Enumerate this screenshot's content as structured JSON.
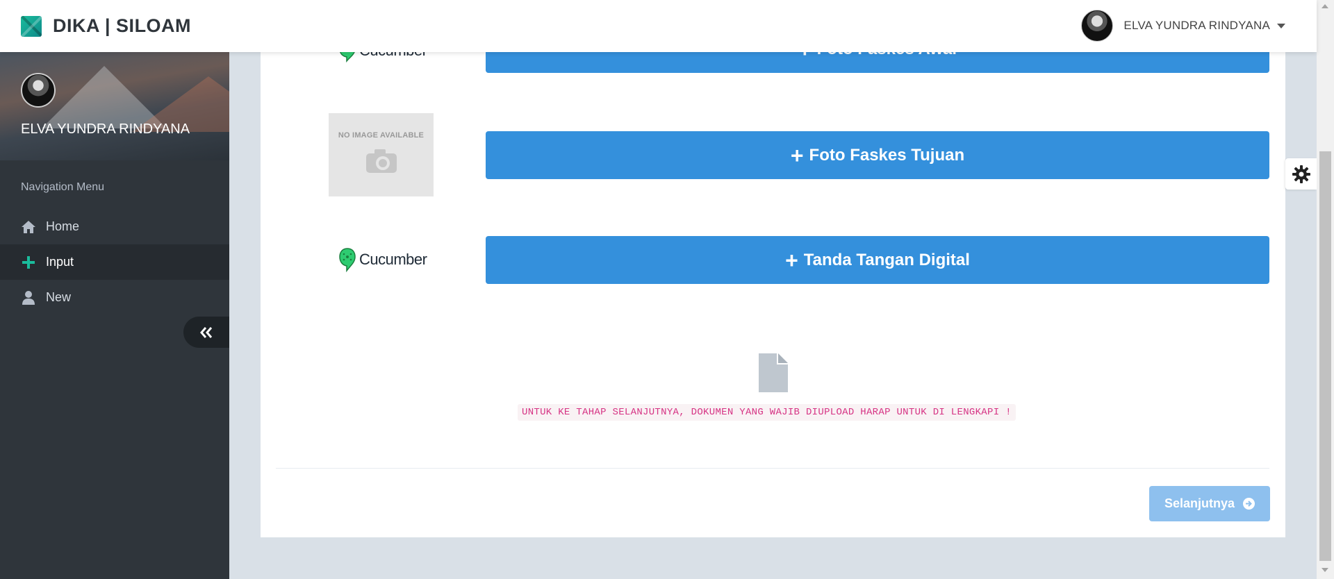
{
  "brand": {
    "name": "DIKA | SILOAM"
  },
  "user": {
    "name": "ELVA YUNDRA RINDYANA"
  },
  "sidebar": {
    "profile_name": "ELVA YUNDRA RINDYANA",
    "nav_header": "Navigation Menu",
    "items": [
      {
        "label": "Home",
        "icon": "home-icon"
      },
      {
        "label": "Input",
        "icon": "plus-icon",
        "active": true
      },
      {
        "label": "New",
        "icon": "user-icon"
      }
    ]
  },
  "uploads": [
    {
      "label": "Foto Faskes Awal",
      "thumb": "Cucumber"
    },
    {
      "label": "Foto Faskes Tujuan",
      "thumb_text": "NO IMAGE AVAILABLE"
    },
    {
      "label": "Tanda Tangan Digital",
      "thumb": "Cucumber"
    }
  ],
  "warning": "UNTUK KE TAHAP SELANJUTNYA, DOKUMEN YANG WAJIB DIUPLOAD HARAP UNTUK DI LENGKAPI !",
  "next_button": {
    "label": "Selanjutnya"
  },
  "colors": {
    "primary": "#3490dc",
    "sidebar": "#2f353b",
    "accent": "#1abc9c",
    "warning_text": "#d63384"
  }
}
